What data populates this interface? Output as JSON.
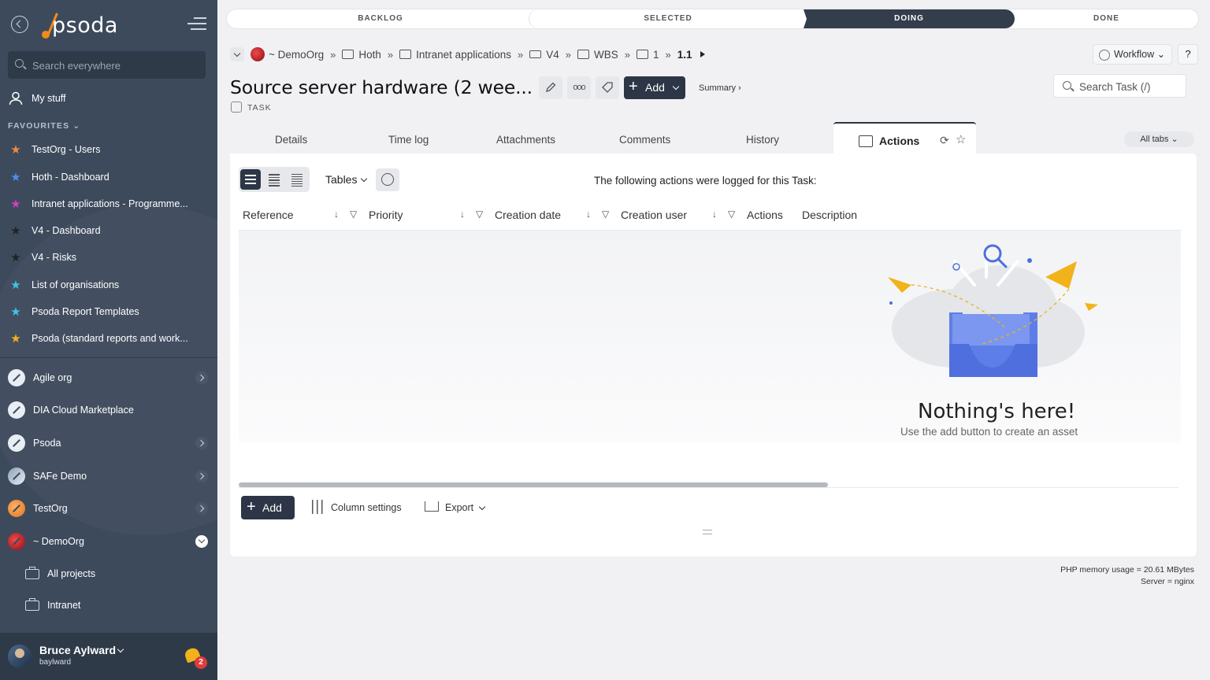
{
  "sidebar": {
    "search_placeholder": "Search everywhere",
    "my_stuff": "My stuff",
    "favourites_label": "FAVOURITES",
    "favourites": [
      {
        "label": "TestOrg - Users",
        "color": "#f08a3c"
      },
      {
        "label": "Hoth - Dashboard",
        "color": "#4a8ff0"
      },
      {
        "label": "Intranet applications - Programme...",
        "color": "#d63dc4"
      },
      {
        "label": "V4 - Dashboard",
        "color": "#222222"
      },
      {
        "label": "V4 - Risks",
        "color": "#222222"
      },
      {
        "label": "List of organisations",
        "color": "#3cc6e8"
      },
      {
        "label": "Psoda Report Templates",
        "color": "#3cc6e8"
      },
      {
        "label": "Psoda (standard reports and work...",
        "color": "#f2b21b"
      }
    ],
    "orgs": [
      {
        "label": "Agile org"
      },
      {
        "label": "DIA Cloud Marketplace"
      },
      {
        "label": "Psoda"
      },
      {
        "label": "SAFe Demo"
      },
      {
        "label": "TestOrg"
      },
      {
        "label": "~ DemoOrg"
      }
    ],
    "sub_items": [
      {
        "label": "All projects"
      },
      {
        "label": "Intranet"
      }
    ],
    "user": {
      "name": "Bruce Aylward",
      "handle": "baylward",
      "notifications": "2"
    }
  },
  "workflow": {
    "steps": [
      "BACKLOG",
      "SELECTED",
      "DOING",
      "DONE"
    ],
    "active": "DOING"
  },
  "breadcrumb": {
    "org": "~ DemoOrg",
    "items": [
      "Hoth",
      "Intranet applications",
      "V4",
      "WBS",
      "1",
      "1.1"
    ],
    "separator": "»"
  },
  "header": {
    "workflow_button": "Workflow",
    "help_button": "?",
    "title": "Source server hardware (2 wee...",
    "type_label": "TASK",
    "add_button": "Add",
    "summary_link": "Summary ›",
    "search_placeholder": "Search Task (/)"
  },
  "tabs": {
    "items": [
      "Details",
      "Time log",
      "Attachments",
      "Comments",
      "History"
    ],
    "active": "Actions",
    "all_tabs": "All tabs"
  },
  "panel": {
    "view_dropdown": "Tables",
    "info_text": "The following actions were logged for this Task:",
    "columns": [
      "Reference",
      "Priority",
      "Creation date",
      "Creation user",
      "Actions",
      "Description"
    ],
    "empty_title": "Nothing's here!",
    "empty_subtitle": "Use the add button to create an asset",
    "add_button": "Add",
    "column_settings": "Column settings",
    "export": "Export"
  },
  "footer": {
    "memory": "PHP memory usage = 20.61 MBytes",
    "server": "Server = nginx"
  },
  "colors": {
    "sidebar_bg": "#3d4a5c",
    "primary_dark": "#2c3646",
    "accent_orange": "#f28b1e"
  }
}
